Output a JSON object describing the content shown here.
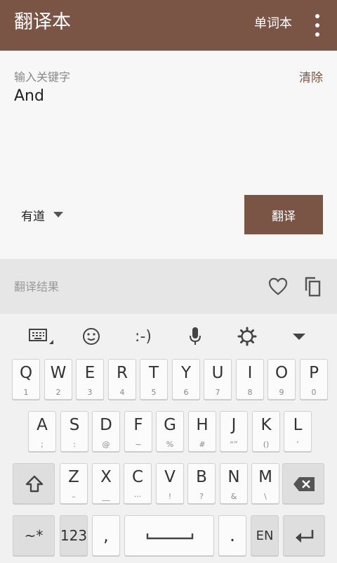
{
  "appbar": {
    "title": "翻译本",
    "wordbook": "单词本"
  },
  "input": {
    "label": "输入关键字",
    "clear": "清除",
    "value": "And"
  },
  "engine": {
    "selected": "有道"
  },
  "translate_button": "翻译",
  "result": {
    "label": "翻译结果"
  },
  "keyboard": {
    "toolbar": {
      "emoticon": ":-)"
    },
    "rows": [
      [
        [
          "Q",
          "1"
        ],
        [
          "W",
          "2"
        ],
        [
          "E",
          "3"
        ],
        [
          "R",
          "4"
        ],
        [
          "T",
          "5"
        ],
        [
          "Y",
          "6"
        ],
        [
          "U",
          "7"
        ],
        [
          "I",
          "8"
        ],
        [
          "O",
          "9"
        ],
        [
          "P",
          "0"
        ]
      ],
      [
        [
          "A",
          ";"
        ],
        [
          "S",
          ":"
        ],
        [
          "D",
          "@"
        ],
        [
          "F",
          "~"
        ],
        [
          "G",
          "%"
        ],
        [
          "H",
          "#"
        ],
        [
          "J",
          "“”"
        ],
        [
          "K",
          "()"
        ],
        [
          "L",
          "’"
        ]
      ],
      [
        [
          "Z",
          "–"
        ],
        [
          "X",
          "__"
        ],
        [
          "C",
          "···"
        ],
        [
          "V",
          "!"
        ],
        [
          "B",
          "?"
        ],
        [
          "N",
          "&"
        ],
        [
          "M",
          "\\"
        ]
      ]
    ],
    "bottom": {
      "symbols": "~*",
      "numbers": "123",
      "comma": ",",
      "period": ".",
      "language": "EN"
    }
  },
  "colors": {
    "brand": "#7a5445"
  }
}
